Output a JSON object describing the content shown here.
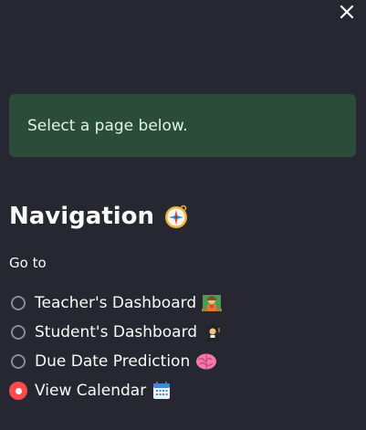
{
  "sidebar": {
    "close_icon": "close-icon",
    "alert_text": "Select a page below.",
    "heading": "Navigation",
    "heading_icon": "compass-icon",
    "radio_label": "Go to",
    "options": [
      {
        "label": "Teacher's Dashboard",
        "icon": "teacher-icon",
        "selected": false
      },
      {
        "label": "Student's Dashboard",
        "icon": "student-icon",
        "selected": false
      },
      {
        "label": "Due Date Prediction",
        "icon": "brain-icon",
        "selected": false
      },
      {
        "label": "View Calendar",
        "icon": "calendar-icon",
        "selected": true
      }
    ]
  },
  "colors": {
    "background": "#262730",
    "alert_background": "#2b4b3b",
    "alert_text": "#dff5e3",
    "accent": "#ff4b4b",
    "radio_border": "#8a8c94"
  }
}
